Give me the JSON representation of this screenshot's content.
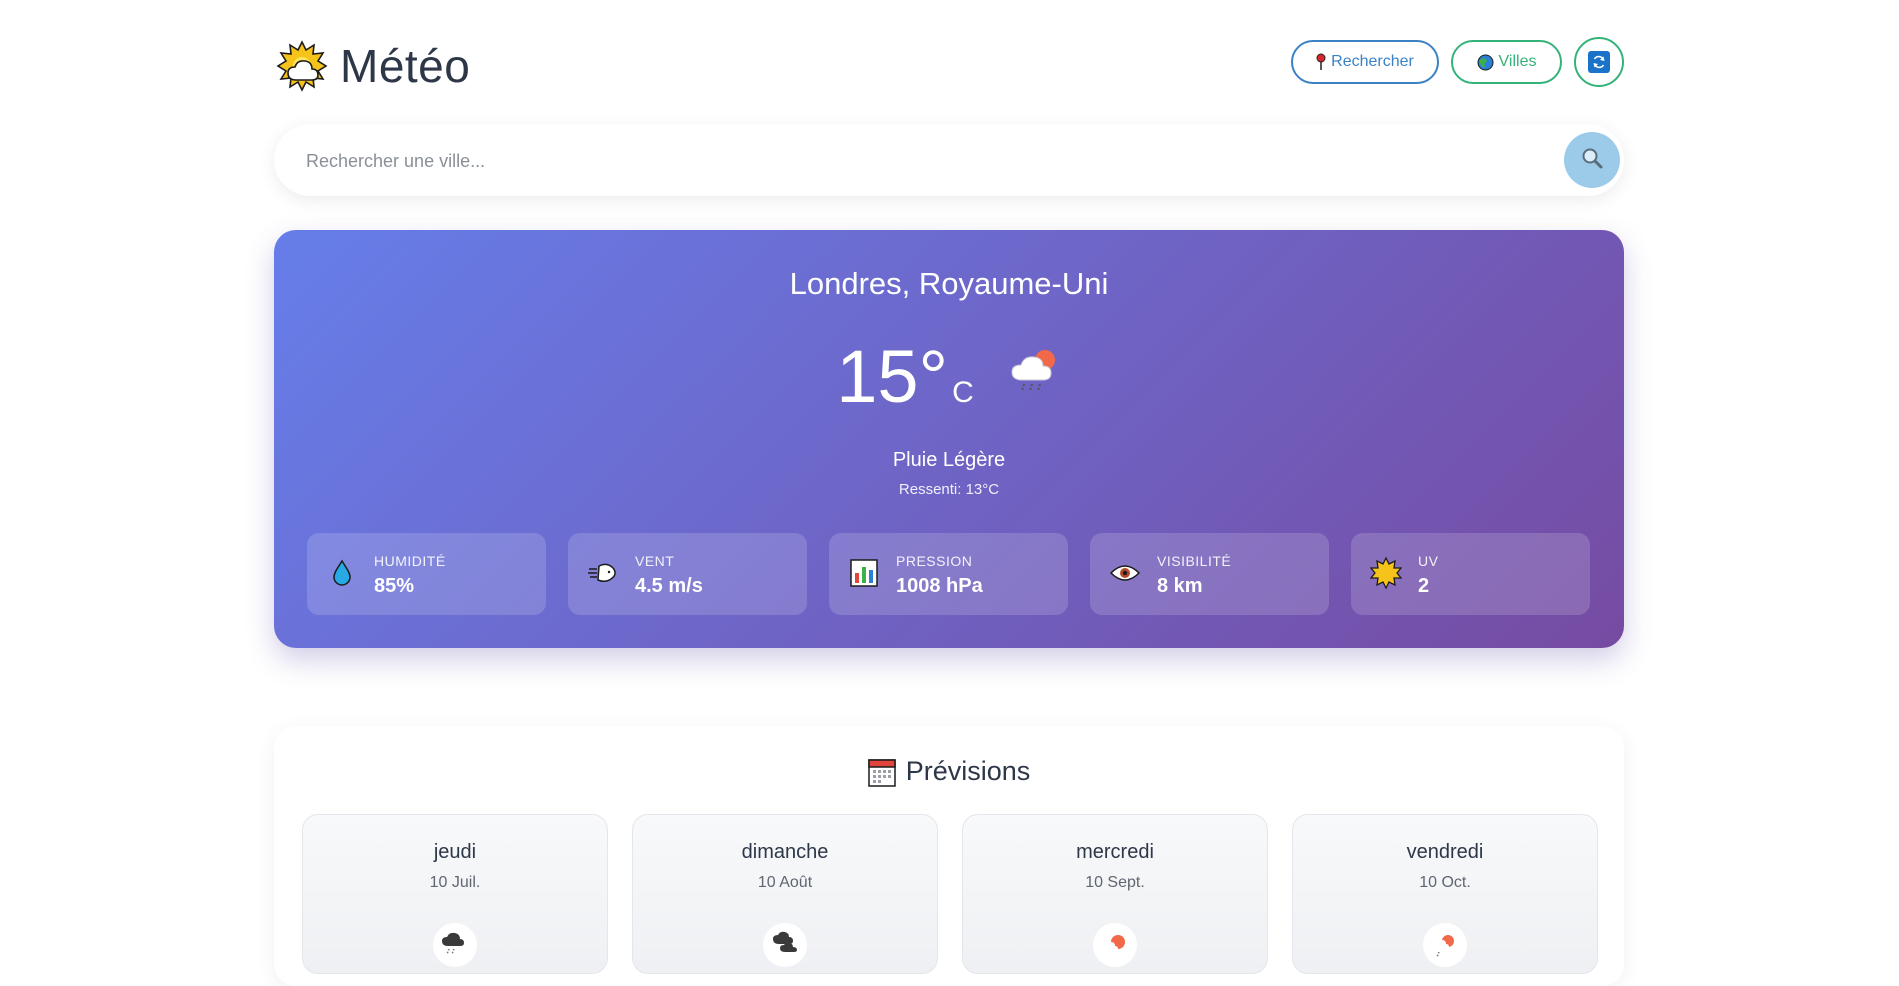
{
  "app": {
    "title": "Météo",
    "logo_icon": "sun-behind-cloud-icon"
  },
  "header": {
    "search_button": {
      "label": "Rechercher",
      "icon": "round-pushpin-icon",
      "color": "#3b82c4"
    },
    "cities_button": {
      "label": "Villes",
      "icon": "globe-icon",
      "color": "#35b27a"
    },
    "refresh_button": {
      "icon": "refresh-icon",
      "color": "#35b27a"
    }
  },
  "search": {
    "placeholder": "Rechercher une ville...",
    "value": "",
    "button_icon": "magnifier-icon"
  },
  "current": {
    "city": "Londres, Royaume-Uni",
    "temperature": "15",
    "degree_symbol": "°",
    "unit": "C",
    "condition_icon": "cloud-rain-sun-icon",
    "description": "Pluie Légère",
    "feels_like": "Ressenti: 13°C",
    "gradient": [
      "#667eea",
      "#764ba2"
    ],
    "stats": [
      {
        "label": "HUMIDITÉ",
        "value": "85%",
        "icon": "droplet-icon"
      },
      {
        "label": "VENT",
        "value": "4.5 m/s",
        "icon": "wind-icon"
      },
      {
        "label": "PRESSION",
        "value": "1008 hPa",
        "icon": "bar-chart-icon"
      },
      {
        "label": "VISIBILITÉ",
        "value": "8 km",
        "icon": "eye-icon"
      },
      {
        "label": "UV",
        "value": "2",
        "icon": "sun-icon"
      }
    ]
  },
  "forecast": {
    "title": "Prévisions",
    "title_icon": "calendar-icon",
    "days": [
      {
        "day": "jeudi",
        "date": "10 Juil.",
        "icon": "cloud-rain-icon"
      },
      {
        "day": "dimanche",
        "date": "10 Août",
        "icon": "cloud-icon"
      },
      {
        "day": "mercredi",
        "date": "10 Sept.",
        "icon": "sun-cloud-icon"
      },
      {
        "day": "vendredi",
        "date": "10 Oct.",
        "icon": "sun-rain-icon"
      }
    ]
  }
}
